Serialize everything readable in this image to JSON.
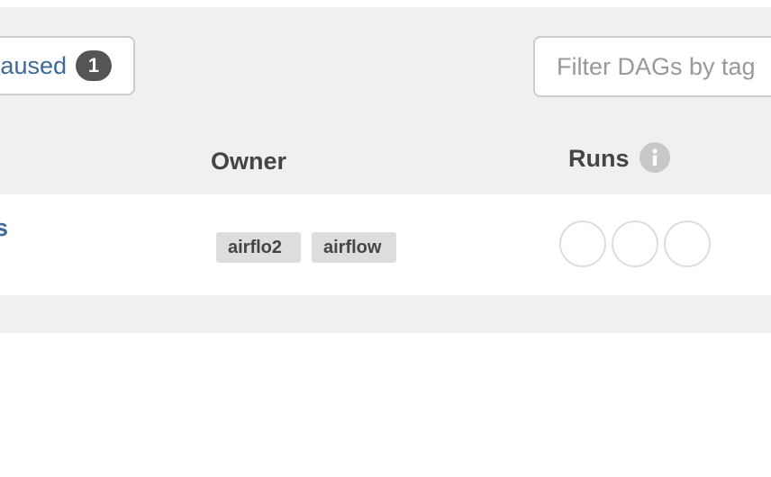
{
  "toolbar": {
    "paused_label": "aused",
    "paused_count": "1",
    "tag_filter_placeholder": "Filter DAGs by tag"
  },
  "table": {
    "headers": {
      "owner": "Owner",
      "runs": "Runs"
    },
    "rows": [
      {
        "dag_fragment": "s",
        "owners": [
          "airflo2",
          "airflow"
        ],
        "runs": [
          {
            "status": "empty"
          },
          {
            "status": "empty"
          },
          {
            "status": "empty"
          }
        ]
      }
    ]
  },
  "icons": {
    "runs_info": "info-icon"
  },
  "colors": {
    "toolbar_background": "#f0f0f0",
    "link": "#3d6a97",
    "badge": "#555555",
    "tag_background": "#dddddd",
    "run_circle_border": "#dddddd"
  }
}
